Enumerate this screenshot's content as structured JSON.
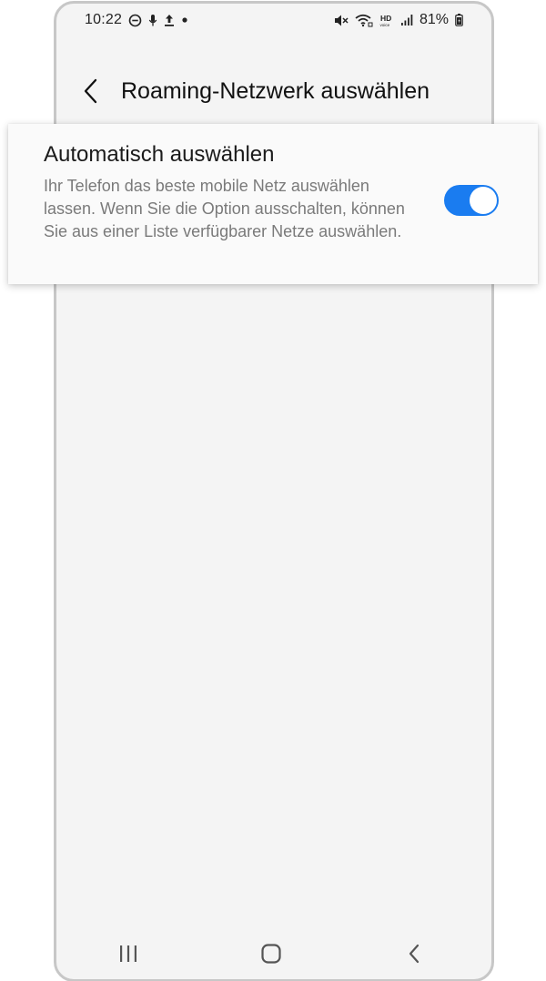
{
  "status_bar": {
    "time": "10:22",
    "battery": "81%",
    "left_icons": [
      "do-not-disturb-icon",
      "microphone-icon",
      "upload-icon",
      "dot-icon"
    ],
    "right_icons": [
      "mute-icon",
      "wifi-call-icon",
      "hd-voice-icon",
      "signal-icon",
      "battery-icon"
    ]
  },
  "header": {
    "title": "Roaming-Netzwerk auswählen",
    "back_icon": "chevron-left-icon"
  },
  "setting": {
    "title": "Automatisch auswählen",
    "description": "Ihr Telefon das beste mobile Netz auswählen lassen. Wenn Sie die Option ausschalten, können Sie aus einer Liste verfügbarer Netze auswählen.",
    "toggle_on": true,
    "toggle_color": "#1a7cf0"
  },
  "nav_bar": {
    "recents_icon": "recents-icon",
    "home_icon": "home-icon",
    "back_icon": "back-icon"
  },
  "colors": {
    "background": "#f4f4f4",
    "card": "#fafafa",
    "accent": "#1a7cf0"
  }
}
